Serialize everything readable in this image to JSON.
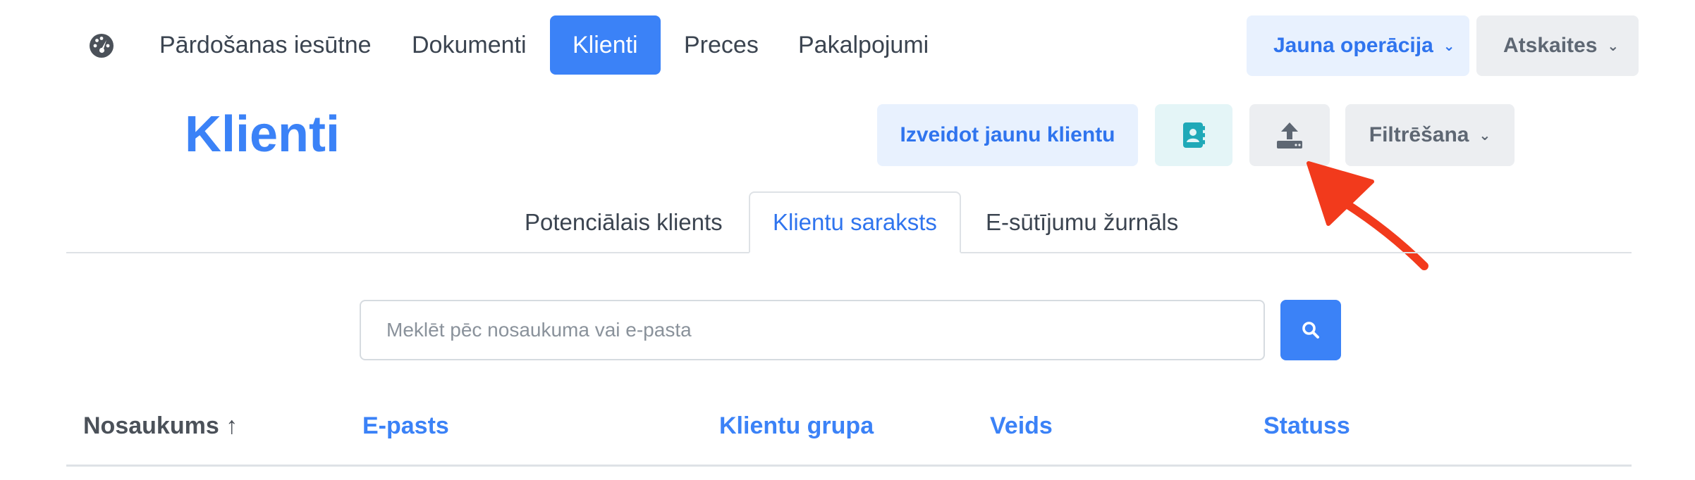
{
  "nav": {
    "dashboard_icon": "speedometer-icon",
    "items": [
      {
        "label": "Pārdošanas iesūtne",
        "active": false
      },
      {
        "label": "Dokumenti",
        "active": false
      },
      {
        "label": "Klienti",
        "active": true
      },
      {
        "label": "Preces",
        "active": false
      },
      {
        "label": "Pakalpojumi",
        "active": false
      }
    ],
    "new_operation_label": "Jauna operācija",
    "reports_label": "Atskaites"
  },
  "page": {
    "title": "Klienti",
    "create_client_label": "Izveidot jaunu klientu",
    "contacts_icon": "address-book-icon",
    "upload_icon": "upload-icon",
    "filter_label": "Filtrēšana"
  },
  "tabs": [
    {
      "label": "Potenciālais klients",
      "active": false
    },
    {
      "label": "Klientu saraksts",
      "active": true
    },
    {
      "label": "E-sūtījumu žurnāls",
      "active": false
    }
  ],
  "search": {
    "placeholder": "Meklēt pēc nosaukuma vai e-pasta",
    "value": ""
  },
  "table": {
    "columns": [
      {
        "label": "Nosaukums ↑",
        "sorted": true
      },
      {
        "label": "E-pasts",
        "sorted": false
      },
      {
        "label": "Klientu grupa",
        "sorted": false
      },
      {
        "label": "Veids",
        "sorted": false
      },
      {
        "label": "Statuss",
        "sorted": false
      }
    ]
  },
  "colors": {
    "accent": "#3b82f7",
    "accent_light": "#e8f1fe",
    "teal": "#1fa9b8",
    "annotation_arrow": "#f23a1c"
  }
}
